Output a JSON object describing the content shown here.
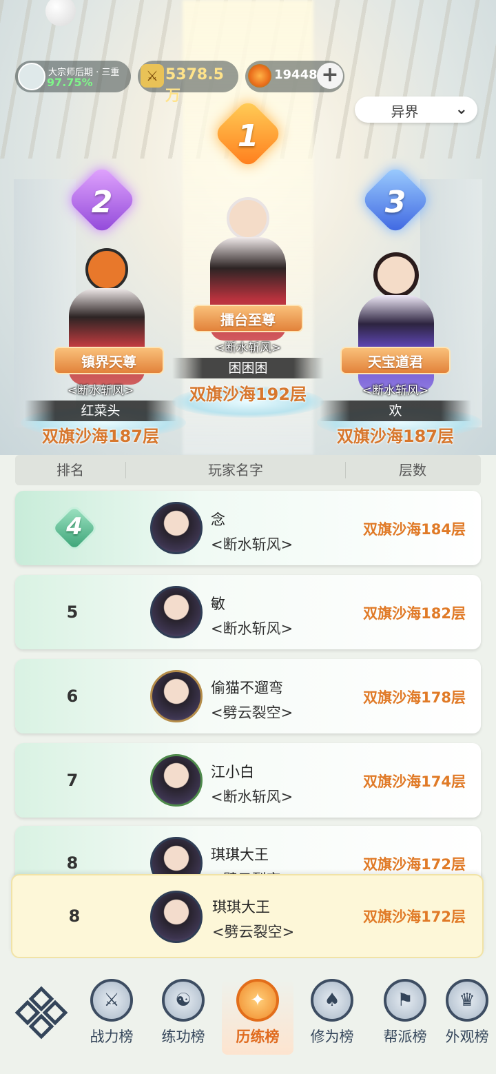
{
  "status_bar": {
    "realm_name": "大宗师后期 · 三重",
    "realm_progress": "97.75%",
    "power_value": "5378.5万",
    "currency_value": "19448",
    "plus_label": "+"
  },
  "server_select": {
    "value": "异界"
  },
  "podium": {
    "first": {
      "rank": "1",
      "title": "擂台至尊",
      "guild": "<断水斩风>",
      "name": "困困困",
      "layer": "双旗沙海192层"
    },
    "second": {
      "rank": "2",
      "title": "镇界天尊",
      "guild": "<断水斩风>",
      "name": "红菜头",
      "layer": "双旗沙海187层"
    },
    "third": {
      "rank": "3",
      "title": "天宝道君",
      "guild": "<断水斩风>",
      "name": "欢",
      "layer": "双旗沙海187层"
    }
  },
  "table_header": {
    "rank": "排名",
    "name": "玩家名字",
    "layer": "层数"
  },
  "rows": [
    {
      "rank": "4",
      "name": "念",
      "guild": "<断水斩风>",
      "layer": "双旗沙海184层"
    },
    {
      "rank": "5",
      "name": "敏",
      "guild": "<断水斩风>",
      "layer": "双旗沙海182层"
    },
    {
      "rank": "6",
      "name": "偷猫不遛弯",
      "guild": "<劈云裂空>",
      "layer": "双旗沙海178层"
    },
    {
      "rank": "7",
      "name": "江小白",
      "guild": "<断水斩风>",
      "layer": "双旗沙海174层"
    },
    {
      "rank": "8",
      "name": "琪琪大王",
      "guild": "<劈云裂空>",
      "layer": "双旗沙海172层"
    }
  ],
  "self_row": {
    "rank": "8",
    "name": "琪琪大王",
    "guild": "<劈云裂空>",
    "layer": "双旗沙海172层"
  },
  "nav": {
    "items": [
      {
        "label": "战力榜",
        "icon": "sword-shield-icon"
      },
      {
        "label": "练功榜",
        "icon": "yin-yang-icon"
      },
      {
        "label": "历练榜",
        "icon": "star-compass-icon"
      },
      {
        "label": "修为榜",
        "icon": "hat-icon"
      },
      {
        "label": "帮派榜",
        "icon": "banner-icon"
      },
      {
        "label": "外观榜",
        "icon": "costume-icon"
      }
    ],
    "active_index": 2
  },
  "colors": {
    "accent": "#e07a27",
    "nav_ink": "#34455a",
    "progress_green": "#7ff48a"
  }
}
